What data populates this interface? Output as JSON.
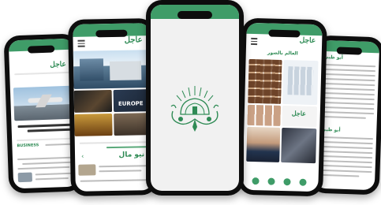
{
  "brand": {
    "logo_text": "عاجل",
    "accent": "#3f9c68"
  },
  "phones": {
    "p1": {
      "ticker": "BUSINESS"
    },
    "p2": {
      "section_label": "نيو مال",
      "image_caption": "EUROPE"
    },
    "p3": {
      "splash_emblem": "mosque-emblem-icon"
    },
    "p4": {
      "heading": "العالم بالصور"
    },
    "p5": {
      "section_one": "أبو ظبي",
      "section_two": "أبو ظبي"
    }
  }
}
